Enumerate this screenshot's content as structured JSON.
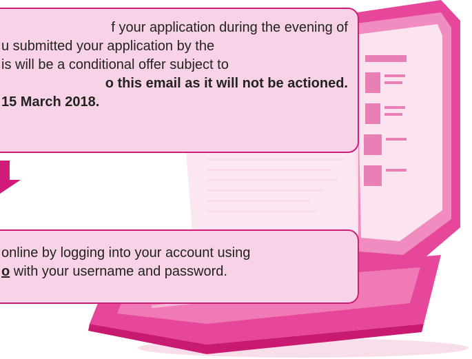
{
  "top_callout": {
    "line1": "f your application during the evening of",
    "line2": "u submitted your application by the",
    "line3": "is will be a conditional offer subject to",
    "line4": "o this email as it will not be actioned.",
    "line5": "15 March 2018."
  },
  "bottom_callout": {
    "line1": "online by logging into your account using",
    "link_text": "o",
    "line2_rest": " with your username and password."
  },
  "colors": {
    "accent": "#d01c78",
    "callout_fill": "#f8d3e8",
    "laptop": "#e6479a"
  },
  "icons": {
    "arrow": "down-arrow-icon",
    "laptop": "laptop-illustration"
  }
}
